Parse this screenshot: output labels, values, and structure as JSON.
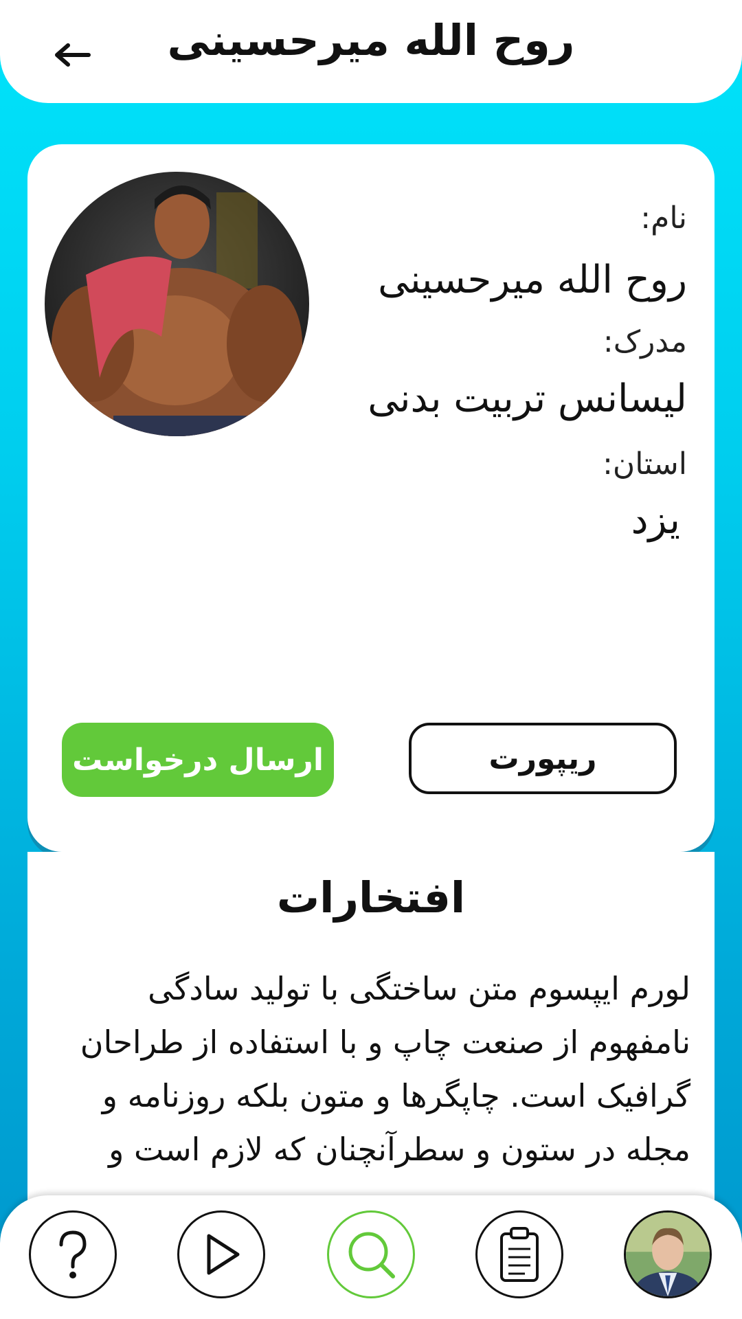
{
  "header": {
    "title": "روح الله میرحسینی",
    "back_icon": "arrow-left-icon"
  },
  "profile": {
    "name_label": "نام:",
    "name_value": "روح الله میرحسینی",
    "degree_label": "مدرک:",
    "degree_value": "لیسانس تربیت بدنی",
    "province_label": "استان:",
    "province_value": "یزد",
    "report_label": "ریپورت",
    "request_label": "ارسال درخواست"
  },
  "achievements": {
    "title": "افتخارات",
    "text": "لورم ایپسوم متن ساختگی با تولید سادگی نامفهوم از صنعت چاپ و با استفاده از طراحان گرافیک است. چاپگرها و متون بلکه روزنامه و مجله در ستون و سطرآنچنان که لازم است و"
  },
  "bottom_nav": {
    "items": [
      "help-icon",
      "play-icon",
      "search-icon",
      "clipboard-icon",
      "user-avatar"
    ],
    "active": "search-icon"
  },
  "colors": {
    "accent_green": "#62c93a",
    "background_cyan": "#00d4f2",
    "text_dark": "#111111"
  }
}
